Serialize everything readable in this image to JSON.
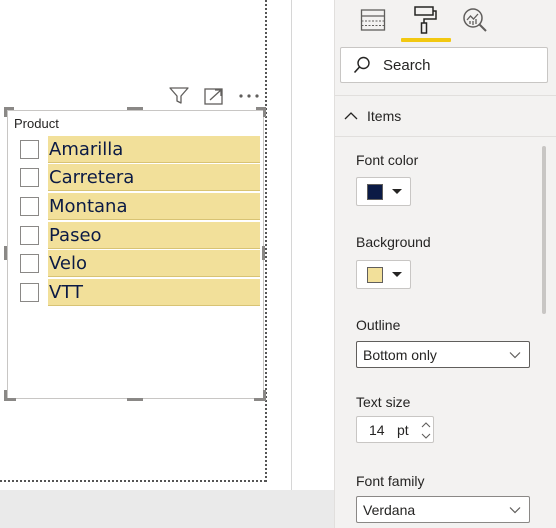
{
  "slicer": {
    "title": "Product",
    "items": [
      {
        "label": "Amarilla"
      },
      {
        "label": "Carretera"
      },
      {
        "label": "Montana"
      },
      {
        "label": "Paseo"
      },
      {
        "label": "Velo"
      },
      {
        "label": "VTT"
      }
    ],
    "item_fill": "#f2e09a",
    "item_font_color": "#0b1a45"
  },
  "visual_header": {
    "icons": [
      "filter-icon",
      "focus-mode-icon",
      "more-options-icon"
    ]
  },
  "pane": {
    "tabs": [
      {
        "icon": "fields-icon",
        "active": false
      },
      {
        "icon": "format-paint-roller-icon",
        "active": true
      },
      {
        "icon": "analytics-icon",
        "active": false
      }
    ],
    "active_tab_color": "#f2c811",
    "search": {
      "label": "Search"
    },
    "section": {
      "title": "Items",
      "expanded": true
    },
    "font_color": {
      "label": "Font color",
      "value": "#0b1a45"
    },
    "background": {
      "label": "Background",
      "value": "#f2e09a"
    },
    "outline": {
      "label": "Outline",
      "value": "Bottom only"
    },
    "text_size": {
      "label": "Text size",
      "value": "14",
      "unit": "pt"
    },
    "font_family": {
      "label": "Font family",
      "value": "Verdana"
    }
  }
}
